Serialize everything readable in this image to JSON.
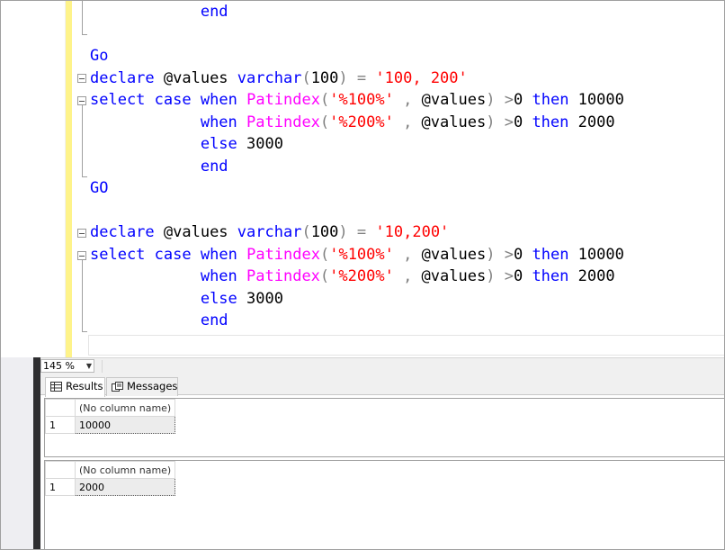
{
  "editor": {
    "lines": [
      {
        "indent": "            ",
        "tokens": [
          {
            "t": "end",
            "c": "kw"
          }
        ]
      },
      {
        "indent": "",
        "tokens": []
      },
      {
        "indent": "",
        "tokens": [
          {
            "t": "Go",
            "c": "kw"
          }
        ]
      },
      {
        "indent": "",
        "tokens": [
          {
            "t": "declare",
            "c": "kw"
          },
          {
            "t": " @values ",
            "c": ""
          },
          {
            "t": "varchar",
            "c": "kw"
          },
          {
            "t": "(",
            "c": "op"
          },
          {
            "t": "100",
            "c": ""
          },
          {
            "t": ")",
            "c": "op"
          },
          {
            "t": " ",
            "c": ""
          },
          {
            "t": "=",
            "c": "op"
          },
          {
            "t": " ",
            "c": ""
          },
          {
            "t": "'100, 200'",
            "c": "str"
          }
        ]
      },
      {
        "indent": "",
        "tokens": [
          {
            "t": "select",
            "c": "kw"
          },
          {
            "t": " ",
            "c": ""
          },
          {
            "t": "case",
            "c": "kw"
          },
          {
            "t": " ",
            "c": ""
          },
          {
            "t": "when",
            "c": "kw"
          },
          {
            "t": " ",
            "c": ""
          },
          {
            "t": "Patindex",
            "c": "fn"
          },
          {
            "t": "(",
            "c": "op"
          },
          {
            "t": "'%100%'",
            "c": "str"
          },
          {
            "t": " , ",
            "c": "op"
          },
          {
            "t": "@values",
            "c": ""
          },
          {
            "t": ")",
            "c": "op"
          },
          {
            "t": " ",
            "c": ""
          },
          {
            "t": ">",
            "c": "op"
          },
          {
            "t": "0 ",
            "c": ""
          },
          {
            "t": "then",
            "c": "kw"
          },
          {
            "t": " 10000",
            "c": ""
          }
        ]
      },
      {
        "indent": "            ",
        "tokens": [
          {
            "t": "when",
            "c": "kw"
          },
          {
            "t": " ",
            "c": ""
          },
          {
            "t": "Patindex",
            "c": "fn"
          },
          {
            "t": "(",
            "c": "op"
          },
          {
            "t": "'%200%'",
            "c": "str"
          },
          {
            "t": " , ",
            "c": "op"
          },
          {
            "t": "@values",
            "c": ""
          },
          {
            "t": ")",
            "c": "op"
          },
          {
            "t": " ",
            "c": ""
          },
          {
            "t": ">",
            "c": "op"
          },
          {
            "t": "0 ",
            "c": ""
          },
          {
            "t": "then",
            "c": "kw"
          },
          {
            "t": " 2000",
            "c": ""
          }
        ]
      },
      {
        "indent": "            ",
        "tokens": [
          {
            "t": "else",
            "c": "kw"
          },
          {
            "t": " 3000",
            "c": ""
          }
        ]
      },
      {
        "indent": "            ",
        "tokens": [
          {
            "t": "end",
            "c": "kw"
          }
        ]
      },
      {
        "indent": "",
        "tokens": [
          {
            "t": "GO",
            "c": "kw"
          }
        ]
      },
      {
        "indent": "",
        "tokens": []
      },
      {
        "indent": "",
        "tokens": [
          {
            "t": "declare",
            "c": "kw"
          },
          {
            "t": " @values ",
            "c": ""
          },
          {
            "t": "varchar",
            "c": "kw"
          },
          {
            "t": "(",
            "c": "op"
          },
          {
            "t": "100",
            "c": ""
          },
          {
            "t": ")",
            "c": "op"
          },
          {
            "t": " ",
            "c": ""
          },
          {
            "t": "=",
            "c": "op"
          },
          {
            "t": " ",
            "c": ""
          },
          {
            "t": "'10,200'",
            "c": "str"
          }
        ]
      },
      {
        "indent": "",
        "tokens": [
          {
            "t": "select",
            "c": "kw"
          },
          {
            "t": " ",
            "c": ""
          },
          {
            "t": "case",
            "c": "kw"
          },
          {
            "t": " ",
            "c": ""
          },
          {
            "t": "when",
            "c": "kw"
          },
          {
            "t": " ",
            "c": ""
          },
          {
            "t": "Patindex",
            "c": "fn"
          },
          {
            "t": "(",
            "c": "op"
          },
          {
            "t": "'%100%'",
            "c": "str"
          },
          {
            "t": " , ",
            "c": "op"
          },
          {
            "t": "@values",
            "c": ""
          },
          {
            "t": ")",
            "c": "op"
          },
          {
            "t": " ",
            "c": ""
          },
          {
            "t": ">",
            "c": "op"
          },
          {
            "t": "0 ",
            "c": ""
          },
          {
            "t": "then",
            "c": "kw"
          },
          {
            "t": " 10000",
            "c": ""
          }
        ]
      },
      {
        "indent": "            ",
        "tokens": [
          {
            "t": "when",
            "c": "kw"
          },
          {
            "t": " ",
            "c": ""
          },
          {
            "t": "Patindex",
            "c": "fn"
          },
          {
            "t": "(",
            "c": "op"
          },
          {
            "t": "'%200%'",
            "c": "str"
          },
          {
            "t": " , ",
            "c": "op"
          },
          {
            "t": "@values",
            "c": ""
          },
          {
            "t": ")",
            "c": "op"
          },
          {
            "t": " ",
            "c": ""
          },
          {
            "t": ">",
            "c": "op"
          },
          {
            "t": "0 ",
            "c": ""
          },
          {
            "t": "then",
            "c": "kw"
          },
          {
            "t": " 2000",
            "c": ""
          }
        ]
      },
      {
        "indent": "            ",
        "tokens": [
          {
            "t": "else",
            "c": "kw"
          },
          {
            "t": " 3000",
            "c": ""
          }
        ]
      },
      {
        "indent": "            ",
        "tokens": [
          {
            "t": "end",
            "c": "kw"
          }
        ]
      }
    ]
  },
  "zoom": {
    "value": "145 %"
  },
  "tabs": {
    "results_label": "Results",
    "messages_label": "Messages"
  },
  "result_grids": [
    {
      "header": "(No column name)",
      "row_number": "1",
      "value": "10000"
    },
    {
      "header": "(No column name)",
      "row_number": "1",
      "value": "2000"
    }
  ],
  "colors": {
    "keyword": "#0000ff",
    "function": "#ff00ff",
    "string": "#ff0000",
    "operator": "#808080",
    "change_bar": "#fef38a"
  }
}
